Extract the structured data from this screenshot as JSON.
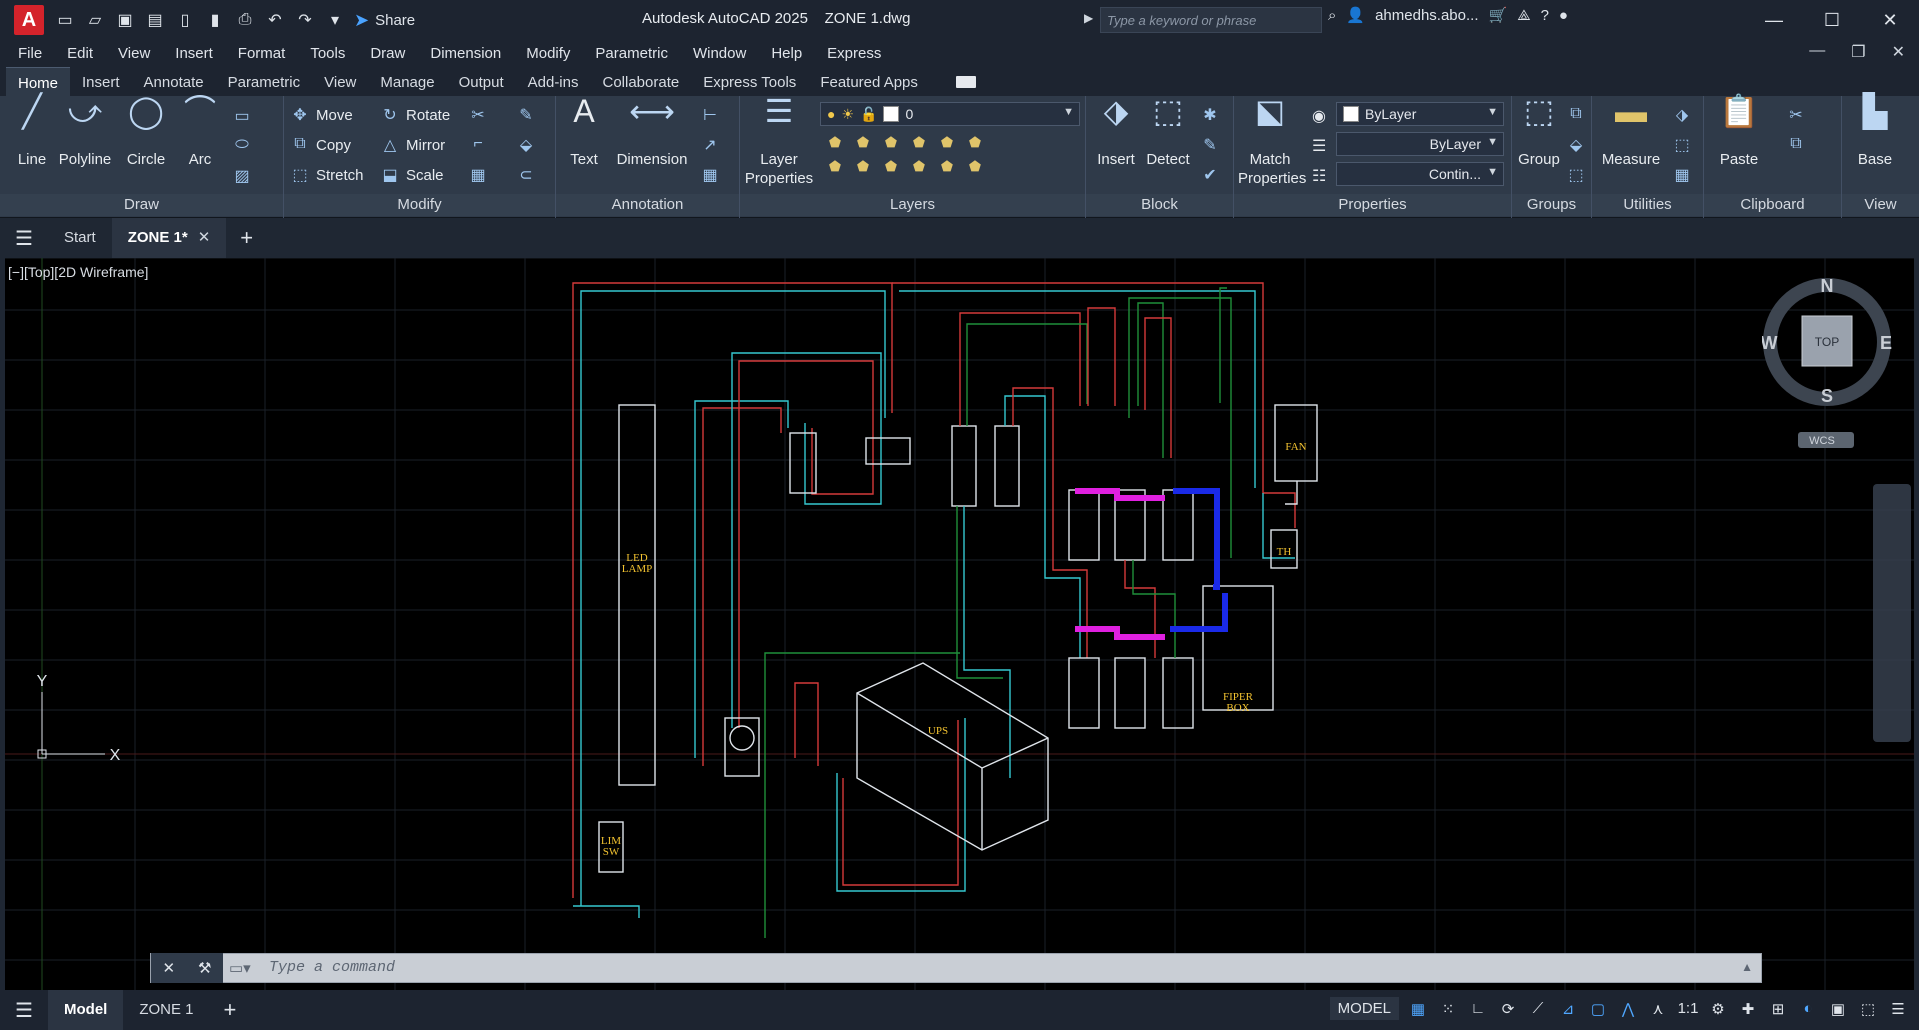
{
  "window": {
    "app_title": "Autodesk AutoCAD 2025",
    "file_name": "ZONE 1.dwg",
    "share_label": "Share",
    "search_placeholder": "Type a keyword or phrase",
    "user_name": "ahmedhs.abo..."
  },
  "menu": [
    "File",
    "Edit",
    "View",
    "Insert",
    "Format",
    "Tools",
    "Draw",
    "Dimension",
    "Modify",
    "Parametric",
    "Window",
    "Help",
    "Express"
  ],
  "ribbon_tabs": [
    "Home",
    "Insert",
    "Annotate",
    "Parametric",
    "View",
    "Manage",
    "Output",
    "Add-ins",
    "Collaborate",
    "Express Tools",
    "Featured Apps"
  ],
  "ribbon": {
    "draw": {
      "label": "Draw",
      "line": "Line",
      "polyline": "Polyline",
      "circle": "Circle",
      "arc": "Arc"
    },
    "modify": {
      "label": "Modify",
      "move": "Move",
      "rotate": "Rotate",
      "copy": "Copy",
      "mirror": "Mirror",
      "stretch": "Stretch",
      "scale": "Scale"
    },
    "annotation": {
      "label": "Annotation",
      "text": "Text",
      "dimension": "Dimension"
    },
    "layers": {
      "label": "Layers",
      "layer_properties_1": "Layer",
      "layer_properties_2": "Properties",
      "current_layer": "0"
    },
    "block": {
      "label": "Block",
      "insert": "Insert",
      "detect": "Detect"
    },
    "properties": {
      "label": "Properties",
      "match_1": "Match",
      "match_2": "Properties",
      "color": "ByLayer",
      "lineweight": "ByLayer",
      "linetype": "Contin..."
    },
    "groups": {
      "label": "Groups",
      "group": "Group"
    },
    "utilities": {
      "label": "Utilities",
      "measure": "Measure"
    },
    "clipboard": {
      "label": "Clipboard",
      "paste": "Paste"
    },
    "view": {
      "label": "View",
      "base": "Base"
    }
  },
  "doc_tabs": {
    "start": "Start",
    "active": "ZONE 1*"
  },
  "viewport": {
    "label": "[−][Top][2D Wireframe]",
    "viewcube": {
      "n": "N",
      "s": "S",
      "e": "E",
      "w": "W",
      "top": "TOP",
      "wcs": "WCS"
    },
    "ucs": {
      "x": "X",
      "y": "Y"
    },
    "drawing_labels": {
      "led_1": "LED",
      "led_2": "LAMP",
      "lim_1": "LIM",
      "lim_2": "SW",
      "ups": "UPS",
      "fan": "FAN",
      "th": "TH",
      "fiber_1": "FIPER",
      "fiber_2": "BOX"
    }
  },
  "command": {
    "placeholder": "Type a command"
  },
  "status": {
    "model_tab": "Model",
    "layout_tab": "ZONE 1",
    "space": "MODEL",
    "scale": "1:1"
  }
}
